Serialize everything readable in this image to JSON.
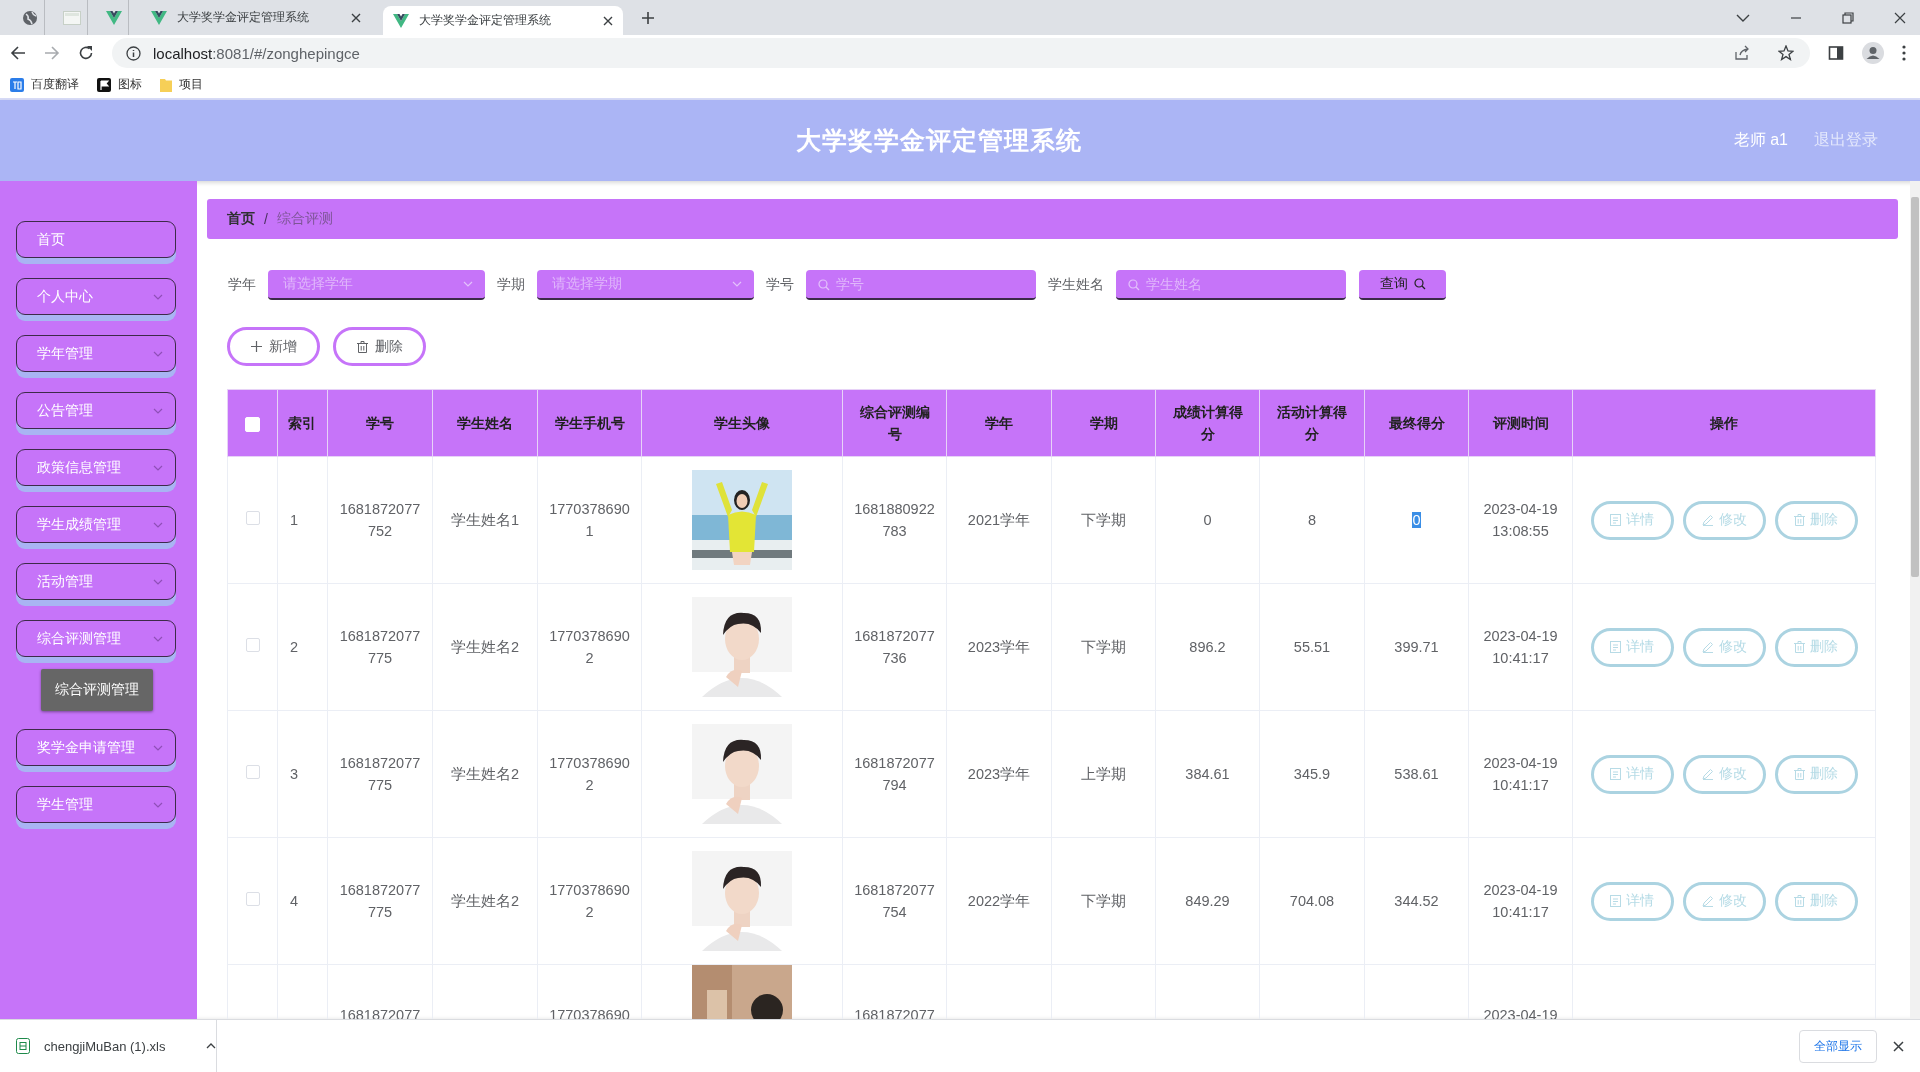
{
  "browser": {
    "tabs": [
      {
        "kind": "globe",
        "selected": false
      },
      {
        "kind": "blank",
        "selected": false
      },
      {
        "kind": "vue",
        "selected": false
      },
      {
        "kind": "vue",
        "title": "大学奖学金评定管理系统",
        "selected": false
      },
      {
        "kind": "vue",
        "title": "大学奖学金评定管理系统",
        "selected": true
      }
    ],
    "address": {
      "host": "localhost",
      "rest": ":8081/#/zonghepingce"
    },
    "bookmarks": [
      {
        "kind": "translate",
        "label": "百度翻译"
      },
      {
        "kind": "flag",
        "label": "图标"
      },
      {
        "kind": "folder",
        "label": "项目"
      }
    ]
  },
  "header": {
    "title": "大学奖学金评定管理系统",
    "user": "老师 a1",
    "logout": "退出登录"
  },
  "sidebar": {
    "items": [
      {
        "label": "首页",
        "kind": "link"
      },
      {
        "label": "个人中心",
        "kind": "menu"
      },
      {
        "label": "学年管理",
        "kind": "menu"
      },
      {
        "label": "公告管理",
        "kind": "menu"
      },
      {
        "label": "政策信息管理",
        "kind": "menu"
      },
      {
        "label": "学生成绩管理",
        "kind": "menu"
      },
      {
        "label": "活动管理",
        "kind": "menu"
      },
      {
        "label": "综合评测管理",
        "kind": "menu",
        "children": [
          {
            "label": "综合评测管理"
          }
        ]
      },
      {
        "label": "奖学金申请管理",
        "kind": "menu"
      },
      {
        "label": "学生管理",
        "kind": "menu"
      }
    ]
  },
  "breadcrumb": {
    "items": [
      "首页",
      "综合评测"
    ],
    "separator": "/"
  },
  "filters": [
    {
      "kind": "select",
      "label": "学年",
      "placeholder": "请选择学年"
    },
    {
      "kind": "select",
      "label": "学期",
      "placeholder": "请选择学期"
    },
    {
      "kind": "search",
      "label": "学号",
      "placeholder": "学号"
    },
    {
      "kind": "search",
      "label": "学生姓名",
      "placeholder": "学生姓名"
    }
  ],
  "search_button": "查询",
  "toolbar": [
    {
      "kind": "add",
      "label": "新增"
    },
    {
      "kind": "delete",
      "label": "删除"
    }
  ],
  "table": {
    "select_all_checked": false,
    "columns": [
      "索引",
      "学号",
      "学生姓名",
      "学生手机号",
      "学生头像",
      "综合评测编号",
      "学年",
      "学期",
      "成绩计算得分",
      "活动计算得分",
      "最终得分",
      "评测时间",
      "操作"
    ],
    "rows": [
      {
        "checked": false,
        "index": "1",
        "student_id": "1681872077752",
        "name": "学生姓名1",
        "phone": "17703786901",
        "avatar": {
          "kind": "picture"
        },
        "eval_no": "1681880922783",
        "year": "2021学年",
        "term": "下学期",
        "grade_score": "0",
        "activity_score": "8",
        "final_score": "0",
        "final_score_highlighted": true,
        "time": "2023-04-19 13:08:55",
        "actions": [
          {
            "kind": "detail",
            "label": "详情"
          },
          {
            "kind": "edit",
            "label": "修改"
          },
          {
            "kind": "delete",
            "label": "删除"
          }
        ]
      },
      {
        "checked": false,
        "index": "2",
        "student_id": "1681872077775",
        "name": "学生姓名2",
        "phone": "17703786902",
        "avatar": {
          "kind": "picture"
        },
        "eval_no": "1681872077736",
        "year": "2023学年",
        "term": "下学期",
        "grade_score": "896.2",
        "activity_score": "55.51",
        "final_score": "399.71",
        "final_score_highlighted": false,
        "time": "2023-04-19 10:41:17",
        "actions": [
          {
            "kind": "detail",
            "label": "详情"
          },
          {
            "kind": "edit",
            "label": "修改"
          },
          {
            "kind": "delete",
            "label": "删除"
          }
        ]
      },
      {
        "checked": false,
        "index": "3",
        "student_id": "1681872077775",
        "name": "学生姓名2",
        "phone": "17703786902",
        "avatar": {
          "kind": "picture"
        },
        "eval_no": "1681872077794",
        "year": "2023学年",
        "term": "上学期",
        "grade_score": "384.61",
        "activity_score": "345.9",
        "final_score": "538.61",
        "final_score_highlighted": false,
        "time": "2023-04-19 10:41:17",
        "actions": [
          {
            "kind": "detail",
            "label": "详情"
          },
          {
            "kind": "edit",
            "label": "修改"
          },
          {
            "kind": "delete",
            "label": "删除"
          }
        ]
      },
      {
        "checked": false,
        "index": "4",
        "student_id": "1681872077775",
        "name": "学生姓名2",
        "phone": "17703786902",
        "avatar": {
          "kind": "picture"
        },
        "eval_no": "1681872077754",
        "year": "2022学年",
        "term": "下学期",
        "grade_score": "849.29",
        "activity_score": "704.08",
        "final_score": "344.52",
        "final_score_highlighted": false,
        "time": "2023-04-19 10:41:17",
        "actions": [
          {
            "kind": "detail",
            "label": "详情"
          },
          {
            "kind": "edit",
            "label": "修改"
          },
          {
            "kind": "delete",
            "label": "删除"
          }
        ]
      },
      {
        "student_id": "1681872077",
        "phone": "1770378690",
        "avatar": {
          "kind": "picture"
        },
        "eval_no": "1681872077",
        "time": "2023-04-19"
      }
    ]
  },
  "download_bar": {
    "file": "chengjiMuBan (1).xls",
    "show_all": "全部显示"
  }
}
